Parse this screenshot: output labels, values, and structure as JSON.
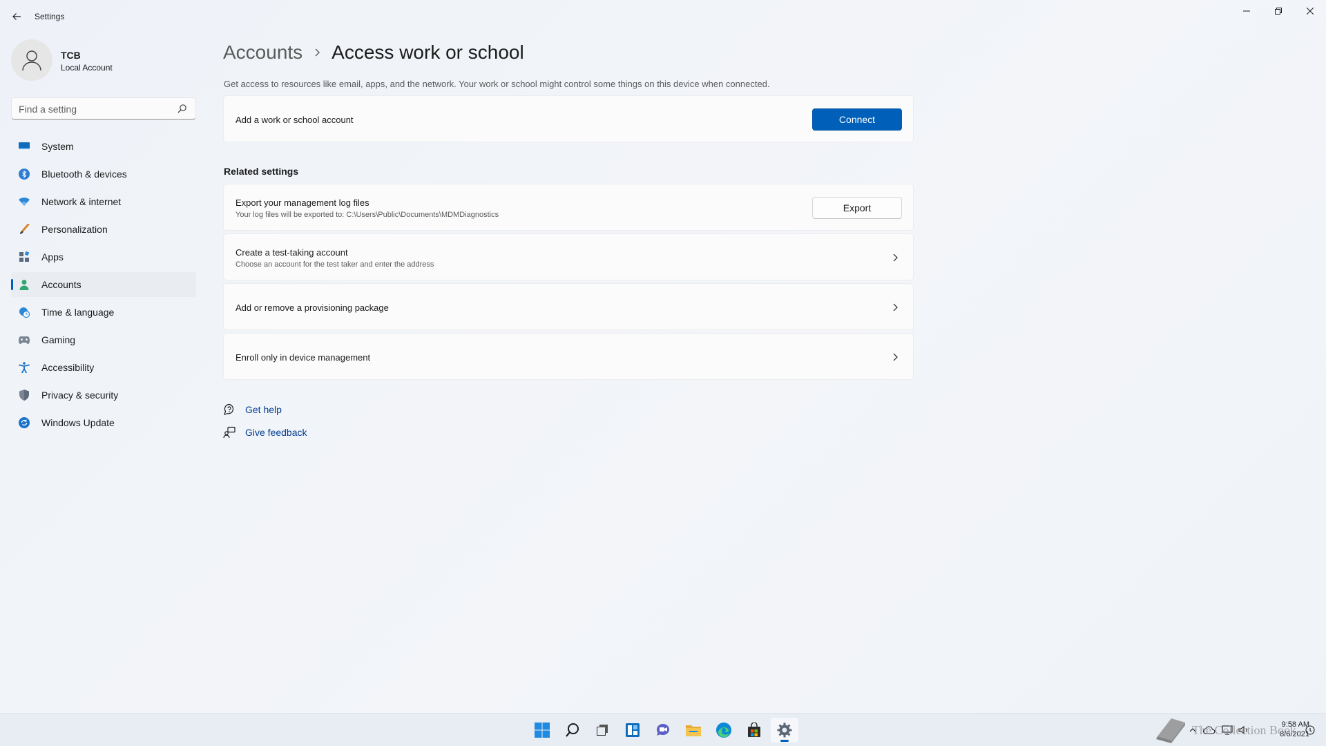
{
  "app": {
    "title": "Settings"
  },
  "profile": {
    "name": "TCB",
    "account_type": "Local Account"
  },
  "search": {
    "placeholder": "Find a setting"
  },
  "sidebar": {
    "items": [
      {
        "label": "System",
        "icon": "monitor-icon"
      },
      {
        "label": "Bluetooth & devices",
        "icon": "bluetooth-icon"
      },
      {
        "label": "Network & internet",
        "icon": "wifi-icon"
      },
      {
        "label": "Personalization",
        "icon": "brush-icon"
      },
      {
        "label": "Apps",
        "icon": "apps-icon"
      },
      {
        "label": "Accounts",
        "icon": "person-icon",
        "active": true
      },
      {
        "label": "Time & language",
        "icon": "globe-clock-icon"
      },
      {
        "label": "Gaming",
        "icon": "gamepad-icon"
      },
      {
        "label": "Accessibility",
        "icon": "accessibility-icon"
      },
      {
        "label": "Privacy & security",
        "icon": "shield-icon"
      },
      {
        "label": "Windows Update",
        "icon": "update-icon"
      }
    ]
  },
  "breadcrumb": {
    "parent": "Accounts",
    "current": "Access work or school"
  },
  "main": {
    "description": "Get access to resources like email, apps, and the network. Your work or school might control some things on this device when connected.",
    "add_account": {
      "title": "Add a work or school account",
      "button": "Connect"
    },
    "related_title": "Related settings",
    "export": {
      "title": "Export your management log files",
      "subtitle": "Your log files will be exported to: C:\\Users\\Public\\Documents\\MDMDiagnostics",
      "button": "Export"
    },
    "test_account": {
      "title": "Create a test-taking account",
      "subtitle": "Choose an account for the test taker and enter the address"
    },
    "provisioning": {
      "title": "Add or remove a provisioning package"
    },
    "enroll": {
      "title": "Enroll only in device management"
    },
    "help": {
      "get_help": "Get help",
      "give_feedback": "Give feedback"
    }
  },
  "taskbar": {
    "icons": [
      "start-icon",
      "search-icon",
      "task-view-icon",
      "widgets-icon",
      "chat-icon",
      "file-explorer-icon",
      "edge-icon",
      "store-icon",
      "settings-icon"
    ],
    "time": "9:58 AM",
    "date": "8/6/2021",
    "watermark": "The Collection Book"
  },
  "colors": {
    "accent": "#005fb8",
    "link": "#003e92",
    "window_bg": "#f3f5f9"
  }
}
